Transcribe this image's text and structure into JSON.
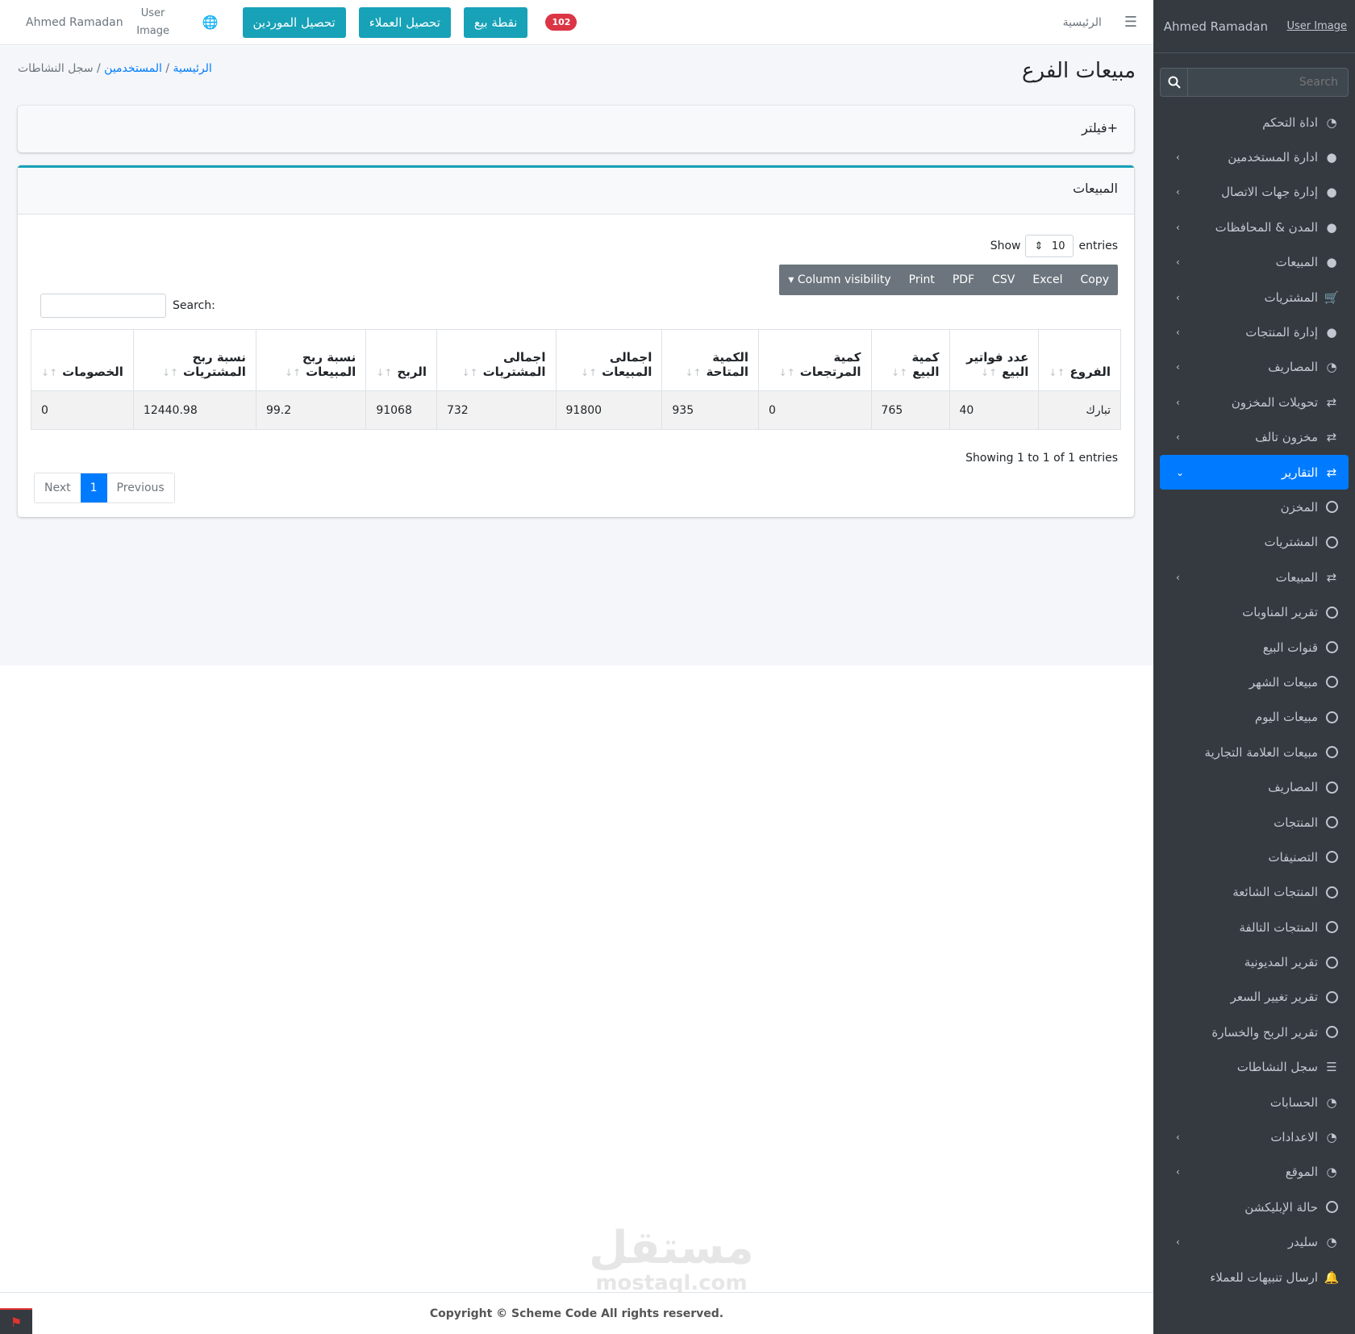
{
  "navbar": {
    "user_name": "Ahmed Ramadan",
    "user_image_alt": "User Image",
    "btn_suppliers": "تحصيل الموردين",
    "btn_customers": "تحصيل العملاء",
    "btn_pos": "نقطة بيع",
    "notification_count": "102",
    "home_link": "الرئيسية"
  },
  "page": {
    "title": "مبيعات الفرع",
    "breadcrumb": {
      "home": "الرئيسية",
      "users": "المستخدمين",
      "current": "سجل النشاطات",
      "separator": "/"
    }
  },
  "filter": {
    "label": "فيلتر+"
  },
  "sales_card": {
    "title": "المبيعات",
    "show_label": "Show",
    "entries_label": "entries",
    "page_length": "10",
    "buttons": [
      "Copy",
      "Excel",
      "CSV",
      "PDF",
      "Print",
      "▾ Column visibility"
    ],
    "search_label": "Search:",
    "columns": [
      "الفروع",
      "عدد فواتير البيع",
      "كمية البيع",
      "كمية المرتجعات",
      "الكمية المتاحة",
      "اجمالى المبيعات",
      "اجمالى المشتريات",
      "الربح",
      "نسبة ربح المبيعات",
      "نسبة ربح المشتريات",
      "الخصومات"
    ],
    "rows": [
      [
        "تبارك",
        "40",
        "765",
        "0",
        "935",
        "91800",
        "732",
        "91068",
        "99.2",
        "12440.98",
        "0"
      ]
    ],
    "info": "Showing 1 to 1 of 1 entries",
    "pagination": {
      "previous": "Previous",
      "current": "1",
      "next": "Next"
    }
  },
  "sidebar": {
    "user_name": "Ahmed Ramadan",
    "user_image_alt": "User Image",
    "search_placeholder": "Search",
    "items": [
      {
        "label": "اداة التحكم",
        "icon": "dashboard-icon",
        "chevron": false,
        "active": false
      },
      {
        "label": "ادارة المستخدمين",
        "icon": "user-icon",
        "chevron": true,
        "active": false
      },
      {
        "label": "إدارة جهات الاتصال",
        "icon": "user-icon",
        "chevron": true,
        "active": false
      },
      {
        "label": "المدن & المحافظات",
        "icon": "user-icon",
        "chevron": true,
        "active": false
      },
      {
        "label": "المبيعات",
        "icon": "user-icon",
        "chevron": true,
        "active": false
      },
      {
        "label": "المشتريات",
        "icon": "cart-icon",
        "chevron": true,
        "active": false
      },
      {
        "label": "إدارة المنتجات",
        "icon": "user-icon",
        "chevron": true,
        "active": false
      },
      {
        "label": "المصاريف",
        "icon": "dashboard-icon",
        "chevron": true,
        "active": false
      },
      {
        "label": "تحويلات المخزون",
        "icon": "exchange-icon",
        "chevron": true,
        "active": false
      },
      {
        "label": "مخزون تالف",
        "icon": "exchange-icon",
        "chevron": true,
        "active": false
      },
      {
        "label": "التقارير",
        "icon": "exchange-icon",
        "chevron": true,
        "active": true
      },
      {
        "label": "المخزن",
        "icon": "circle-icon",
        "chevron": false,
        "active": false
      },
      {
        "label": "المشتريات",
        "icon": "circle-icon",
        "chevron": false,
        "active": false
      },
      {
        "label": "المبيعات",
        "icon": "exchange-icon",
        "chevron": true,
        "active": false
      },
      {
        "label": "تقرير المناوبات",
        "icon": "circle-icon",
        "chevron": false,
        "active": false
      },
      {
        "label": "قنوات البيع",
        "icon": "circle-icon",
        "chevron": false,
        "active": false
      },
      {
        "label": "مبيعات الشهر",
        "icon": "circle-icon",
        "chevron": false,
        "active": false
      },
      {
        "label": "مبيعات اليوم",
        "icon": "circle-icon",
        "chevron": false,
        "active": false
      },
      {
        "label": "مبيعات العلامة التجارية",
        "icon": "circle-icon",
        "chevron": false,
        "active": false
      },
      {
        "label": "المصاريف",
        "icon": "circle-icon",
        "chevron": false,
        "active": false
      },
      {
        "label": "المنتجات",
        "icon": "circle-icon",
        "chevron": false,
        "active": false
      },
      {
        "label": "التصنيفات",
        "icon": "circle-icon",
        "chevron": false,
        "active": false
      },
      {
        "label": "المنتجات الشائعة",
        "icon": "circle-icon",
        "chevron": false,
        "active": false
      },
      {
        "label": "المنتجات التالفة",
        "icon": "circle-icon",
        "chevron": false,
        "active": false
      },
      {
        "label": "تقرير المديونية",
        "icon": "circle-icon",
        "chevron": false,
        "active": false
      },
      {
        "label": "تقرير تغيير السعر",
        "icon": "circle-icon",
        "chevron": false,
        "active": false
      },
      {
        "label": "تقرير الربح والخسارة",
        "icon": "circle-icon",
        "chevron": false,
        "active": false
      },
      {
        "label": "سجل النشاطات",
        "icon": "list-icon",
        "chevron": false,
        "active": false
      },
      {
        "label": "الحسابات",
        "icon": "dashboard-icon",
        "chevron": false,
        "active": false
      },
      {
        "label": "الاعدادات",
        "icon": "dashboard-icon",
        "chevron": true,
        "active": false
      },
      {
        "label": "الموقع",
        "icon": "dashboard-icon",
        "chevron": true,
        "active": false
      },
      {
        "label": "حالة الإبليكشن",
        "icon": "circle-icon",
        "chevron": false,
        "active": false
      },
      {
        "label": "سليدر",
        "icon": "dashboard-icon",
        "chevron": true,
        "active": false
      },
      {
        "label": "ارسال تنبيهات للعملاء",
        "icon": "bell-icon",
        "chevron": false,
        "active": false
      }
    ]
  },
  "footer": {
    "copyright": "Copyright © Scheme Code All rights reserved."
  },
  "watermark": {
    "arabic": "مستقل",
    "latin": "mostaql.com"
  },
  "colors": {
    "sidebar_bg": "#343a40",
    "primary": "#007bff",
    "info": "#17a2b8",
    "danger": "#dc3545",
    "secondary": "#6c757d"
  }
}
